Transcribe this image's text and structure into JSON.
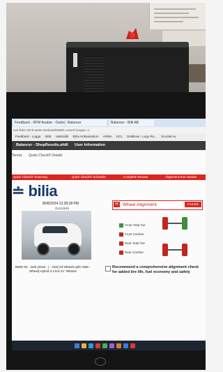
{
  "browser": {
    "tabs": [
      "Feedback - RFM Avabar - Outlook",
      "Balancer",
      "Balancer - Bilti AB"
    ],
    "url": "e24-f6b2-4b79-a648-3a4b2a5f38d0h=search?pagec=1",
    "bookmarks": [
      "Feedback - Logga",
      "SEB",
      "Vasttrafik",
      "Bilia Ambassadors",
      "ARMA",
      "HCL",
      "SnäBoxe - Logo Ru...",
      "Scootie nu"
    ]
  },
  "app": {
    "title": "Balancer - ShopResults.aht6",
    "user_info": "User Information",
    "subnav_a": "Tennis",
    "subnav_b": "Quick Check® Details"
  },
  "steps": [
    "Quick Check® Summary",
    "Quick Check® Schedule",
    "Complete Review",
    "Alignment Run Header"
  ],
  "report": {
    "brand": "bilia",
    "date": "8/08/2024 12:28:28 PM",
    "license": "GUU1545",
    "vehicle": "BMW X5 - G05 (2018 - ) - G05 [All Wheels with AWD - Wheel] Hybrid 2.4 Ext 21\" Wheels",
    "alignment_title": "Wheel Alignment",
    "status": "FAILED",
    "checks": [
      {
        "label": "Front Total Toe",
        "ok": true
      },
      {
        "label": "Front Camber",
        "ok": false
      },
      {
        "label": "Rear Total Toe",
        "ok": false
      },
      {
        "label": "Rear Camber",
        "ok": false
      }
    ],
    "recommendation": "Recommend a comprehensive alignment check for added tire life, fuel economy and safety"
  },
  "colors": {
    "accent": "#d8281f",
    "pass": "#3e8f3e",
    "fail": "#c2261f",
    "brand": "#1b3a6f"
  }
}
